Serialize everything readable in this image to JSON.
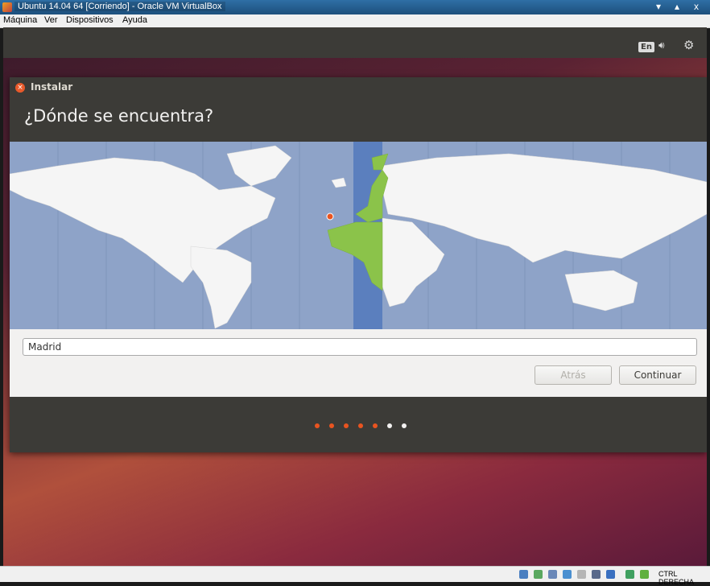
{
  "window": {
    "title": "Ubuntu 14.04 64 [Corriendo] - Oracle VM VirtualBox",
    "controls": [
      "▾",
      "▴",
      "x"
    ]
  },
  "menubar": {
    "items": [
      "Máquina",
      "Ver",
      "Dispositivos",
      "Ayuda"
    ]
  },
  "panel": {
    "keyboard_layout": "En",
    "volume_icon": "speaker-icon",
    "settings_icon": "gear-icon"
  },
  "installer": {
    "window_title": "Instalar",
    "heading": "¿Dónde se encuentra?",
    "city_value": "Madrid",
    "back_label": "Atrás",
    "continue_label": "Continuar",
    "progress": {
      "total": 7,
      "completed": 5
    }
  },
  "statusbar": {
    "host_key": "CTRL DERECHA"
  },
  "colors": {
    "ubuntu_orange": "#e95420",
    "dialog_dark": "#3c3b37",
    "ocean": "#8ea3c8",
    "land": "#f5f5f5",
    "timezone_highlight": "#5b7fbe",
    "selected_zone_land": "#8bc34a"
  }
}
